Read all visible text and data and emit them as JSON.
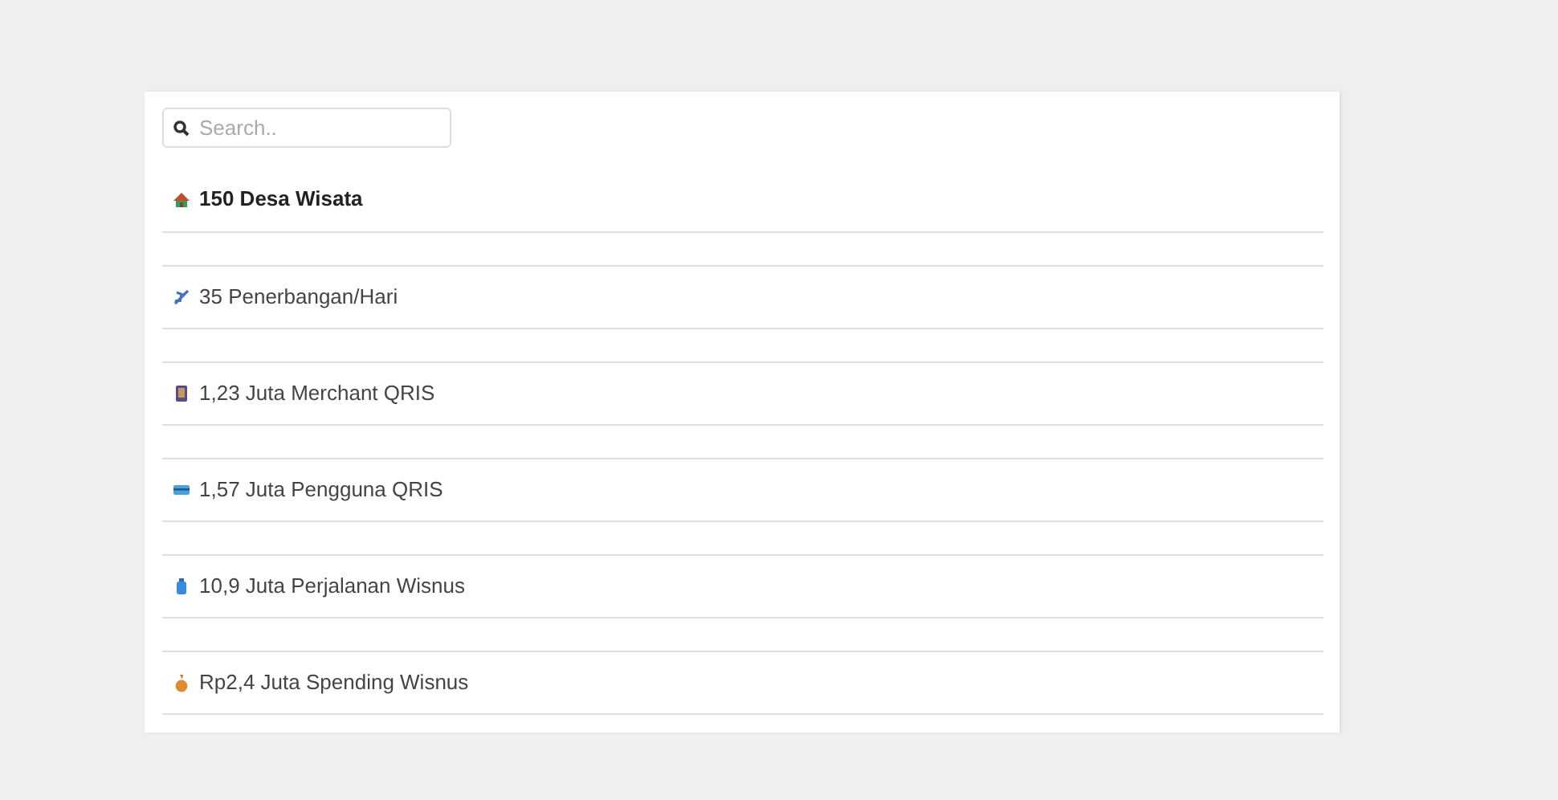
{
  "search": {
    "placeholder": "Search.."
  },
  "items": [
    {
      "label": "150 Desa Wisata",
      "selected": true
    },
    {
      "label": "35 Penerbangan/Hari",
      "selected": false
    },
    {
      "label": "1,23 Juta Merchant QRIS",
      "selected": false
    },
    {
      "label": "1,57 Juta Pengguna QRIS",
      "selected": false
    },
    {
      "label": "10,9 Juta Perjalanan Wisnus",
      "selected": false
    },
    {
      "label": "Rp2,4 Juta Spending Wisnus",
      "selected": false
    }
  ]
}
